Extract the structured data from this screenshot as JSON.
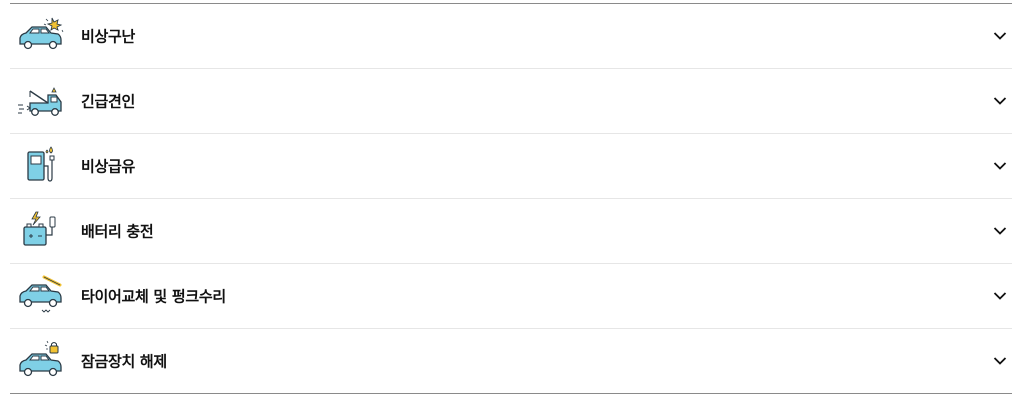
{
  "colors": {
    "icon_fill": "#7fd0e6",
    "icon_stroke": "#2b3a45",
    "accent": "#f2c233",
    "text": "#111111"
  },
  "services": [
    {
      "label": "비상구난",
      "icon": "car-spark-icon"
    },
    {
      "label": "긴급견인",
      "icon": "tow-truck-icon"
    },
    {
      "label": "비상급유",
      "icon": "fuel-pump-icon"
    },
    {
      "label": "배터리 충전",
      "icon": "battery-charge-icon"
    },
    {
      "label": "타이어교체 및 펑크수리",
      "icon": "tire-wrench-icon"
    },
    {
      "label": "잠금장치 해제",
      "icon": "car-lock-icon"
    }
  ],
  "expand_icon": "chevron-down-icon"
}
